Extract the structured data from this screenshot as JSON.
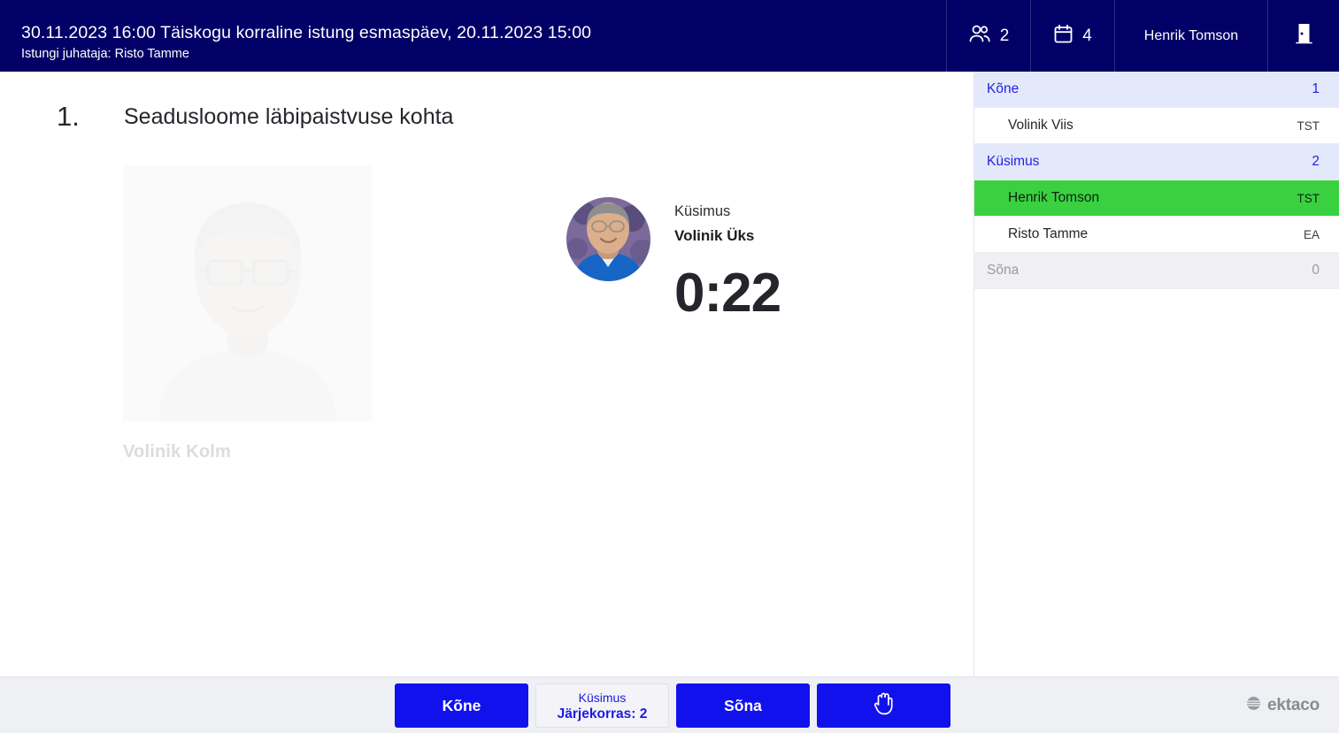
{
  "header": {
    "title": "30.11.2023 16:00 Täiskogu korraline istung esmaspäev, 20.11.2023 15:00",
    "subtitle": "Istungi juhataja: Risto Tamme",
    "participants_icon": "users-icon",
    "participants_count": "2",
    "agenda_icon": "calendar-icon",
    "agenda_count": "4",
    "user_name": "Henrik Tomson",
    "exit_icon": "exit-door-icon",
    "background_color": "#000066"
  },
  "main": {
    "agenda_number": "1.",
    "agenda_title": "Seadusloome läbipaistvuse kohta",
    "previous_speaker": {
      "name": "Volinik Kolm"
    },
    "active_speaker": {
      "kind": "Küsimus",
      "name": "Volinik Üks",
      "timer": "0:22"
    }
  },
  "sidebar": {
    "rows": [
      {
        "type": "group",
        "label": "Kõne",
        "right": "1",
        "muted": false
      },
      {
        "type": "item",
        "label": "Volinik Viis",
        "right": "TST",
        "active": false
      },
      {
        "type": "group",
        "label": "Küsimus",
        "right": "2",
        "muted": false
      },
      {
        "type": "item",
        "label": "Henrik Tomson",
        "right": "TST",
        "active": true
      },
      {
        "type": "item",
        "label": "Risto Tamme",
        "right": "EA",
        "active": false
      },
      {
        "type": "group",
        "label": "Sõna",
        "right": "0",
        "muted": true
      }
    ],
    "active_color": "#3ad141",
    "group_color": "#e3e9fb"
  },
  "footer": {
    "buttons": {
      "kone": "Kõne",
      "kusimus_line1": "Küsimus",
      "kusimus_line2": "Järjekorras: 2",
      "sona": "Sõna",
      "hand_icon": "raise-hand-icon"
    },
    "brand": "ektaco",
    "brand_icon": "ektaco-sphere-icon",
    "primary_color": "#1111ee"
  }
}
